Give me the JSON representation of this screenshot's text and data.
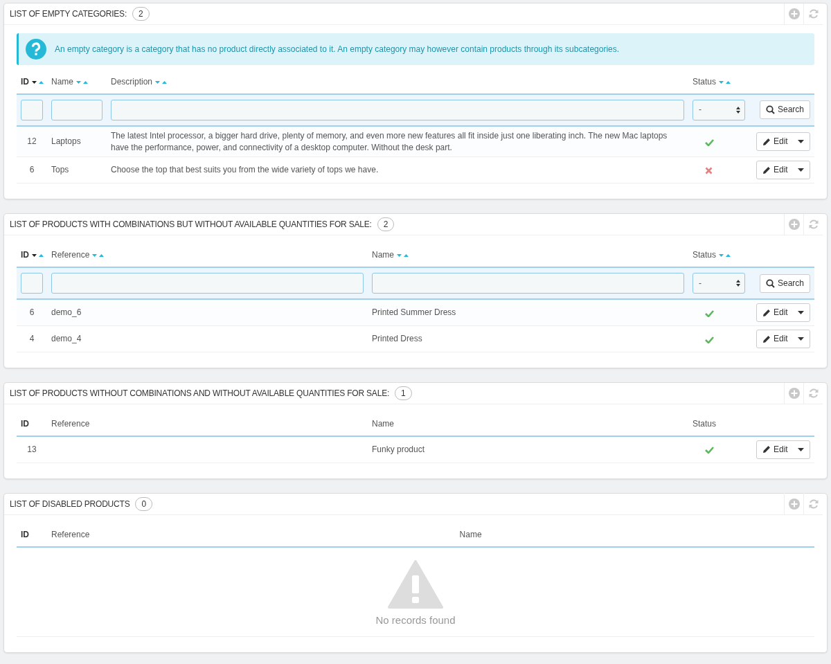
{
  "panels": [
    {
      "title": "LIST OF EMPTY CATEGORIES:",
      "count": "2",
      "info": "An empty category is a category that has no product directly associated to it. An empty category may however contain products through its subcategories.",
      "columns": [
        {
          "label": "ID",
          "kind": "id",
          "sortable": true,
          "sorted_desc": true
        },
        {
          "label": "Name",
          "kind": "short",
          "sortable": true,
          "sorted_desc": false
        },
        {
          "label": "Description",
          "kind": "wide",
          "sortable": true,
          "sorted_desc": false
        },
        {
          "label": "Status",
          "kind": "status",
          "sortable": true,
          "sorted_desc": false
        }
      ],
      "filters": [
        {
          "kind": "text"
        },
        {
          "kind": "text"
        },
        {
          "kind": "text"
        },
        {
          "kind": "select",
          "value": "-"
        }
      ],
      "search_button": "Search",
      "rows": [
        {
          "cells": [
            "12",
            "Laptops",
            "The latest Intel processor, a bigger hard drive, plenty of memory, and even more new features all fit inside just one liberating inch. The new Mac laptops have the performance, power, and connectivity of a desktop computer. Without the desk part."
          ],
          "enabled": true,
          "action": "Edit"
        },
        {
          "cells": [
            "6",
            "Tops",
            "Choose the top that best suits you from the wide variety of tops we have."
          ],
          "enabled": false,
          "action": "Edit"
        }
      ]
    },
    {
      "title": "LIST OF PRODUCTS WITH COMBINATIONS BUT WITHOUT AVAILABLE QUANTITIES FOR SALE:",
      "count": "2",
      "columns": [
        {
          "label": "ID",
          "kind": "id",
          "sortable": true,
          "sorted_desc": true
        },
        {
          "label": "Reference",
          "kind": "wide",
          "sortable": true,
          "sorted_desc": false
        },
        {
          "label": "Name",
          "kind": "wide",
          "sortable": true,
          "sorted_desc": false
        },
        {
          "label": "Status",
          "kind": "status",
          "sortable": true,
          "sorted_desc": false
        }
      ],
      "filters": [
        {
          "kind": "text"
        },
        {
          "kind": "text"
        },
        {
          "kind": "text"
        },
        {
          "kind": "select",
          "value": "-"
        }
      ],
      "search_button": "Search",
      "rows": [
        {
          "cells": [
            "6",
            "demo_6",
            "Printed Summer Dress"
          ],
          "enabled": true,
          "action": "Edit"
        },
        {
          "cells": [
            "4",
            "demo_4",
            "Printed Dress"
          ],
          "enabled": true,
          "action": "Edit"
        }
      ]
    },
    {
      "title": "LIST OF PRODUCTS WITHOUT COMBINATIONS AND WITHOUT AVAILABLE QUANTITIES FOR SALE:",
      "count": "1",
      "columns": [
        {
          "label": "ID",
          "kind": "id"
        },
        {
          "label": "Reference",
          "kind": "wide"
        },
        {
          "label": "Name",
          "kind": "wide"
        },
        {
          "label": "Status",
          "kind": "status"
        }
      ],
      "rows": [
        {
          "cells": [
            "13",
            "",
            "Funky product"
          ],
          "enabled": true,
          "action": "Edit"
        }
      ]
    },
    {
      "title": "LIST OF DISABLED PRODUCTS",
      "count": "0",
      "columns": [
        {
          "label": "ID",
          "kind": "id"
        },
        {
          "label": "Reference",
          "kind": "wide"
        },
        {
          "label": "Name",
          "kind": "wide"
        }
      ],
      "empty_message": "No records found"
    }
  ]
}
